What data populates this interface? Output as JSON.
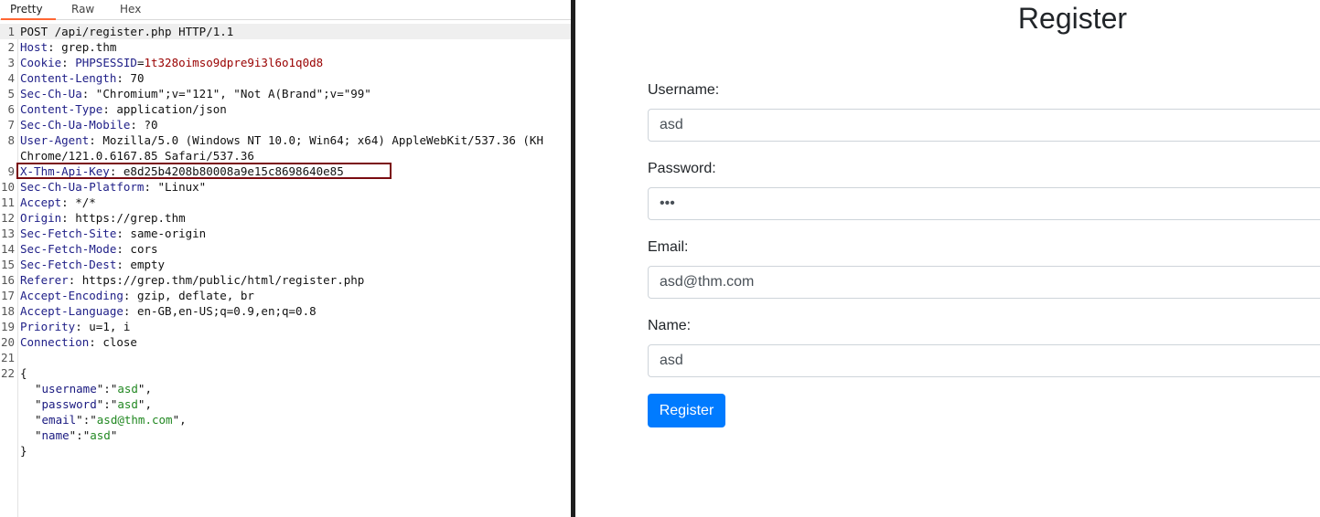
{
  "tabs": {
    "pretty": "Pretty",
    "raw": "Raw",
    "hex": "Hex"
  },
  "request": {
    "lines": [
      {
        "n": "1",
        "text": "POST /api/register.php HTTP/1.1"
      },
      {
        "n": "2",
        "name": "Host",
        "value": "grep.thm"
      },
      {
        "n": "3",
        "name": "Cookie",
        "cookie_name": "PHPSESSID",
        "cookie_value": "1t328oimso9dpre9i3l6o1q0d8"
      },
      {
        "n": "4",
        "name": "Content-Length",
        "value": "70"
      },
      {
        "n": "5",
        "name": "Sec-Ch-Ua",
        "value": "\"Chromium\";v=\"121\", \"Not A(Brand\";v=\"99\""
      },
      {
        "n": "6",
        "name": "Content-Type",
        "value": "application/json"
      },
      {
        "n": "7",
        "name": "Sec-Ch-Ua-Mobile",
        "value": "?0"
      },
      {
        "n": "8",
        "name": "User-Agent",
        "value": "Mozilla/5.0 (Windows NT 10.0; Win64; x64) AppleWebKit/537.36 (KH"
      },
      {
        "n": "",
        "text": "Chrome/121.0.6167.85 Safari/537.36"
      },
      {
        "n": "9",
        "name": "X-Thm-Api-Key",
        "value": "e8d25b4208b80008a9e15c8698640e85"
      },
      {
        "n": "10",
        "name": "Sec-Ch-Ua-Platform",
        "value": "\"Linux\""
      },
      {
        "n": "11",
        "name": "Accept",
        "value": "*/*"
      },
      {
        "n": "12",
        "name": "Origin",
        "value": "https://grep.thm"
      },
      {
        "n": "13",
        "name": "Sec-Fetch-Site",
        "value": "same-origin"
      },
      {
        "n": "14",
        "name": "Sec-Fetch-Mode",
        "value": "cors"
      },
      {
        "n": "15",
        "name": "Sec-Fetch-Dest",
        "value": "empty"
      },
      {
        "n": "16",
        "name": "Referer",
        "value": "https://grep.thm/public/html/register.php"
      },
      {
        "n": "17",
        "name": "Accept-Encoding",
        "value": "gzip, deflate, br"
      },
      {
        "n": "18",
        "name": "Accept-Language",
        "value": "en-GB,en-US;q=0.9,en;q=0.8"
      },
      {
        "n": "19",
        "name": "Priority",
        "value": "u=1, i"
      },
      {
        "n": "20",
        "name": "Connection",
        "value": "close"
      },
      {
        "n": "21",
        "text": ""
      },
      {
        "n": "22",
        "text": "{"
      },
      {
        "n": "",
        "key": "username",
        "val": "asd",
        "trail": ","
      },
      {
        "n": "",
        "key": "password",
        "val": "asd",
        "trail": ","
      },
      {
        "n": "",
        "key": "email",
        "val": "asd@thm.com",
        "trail": ","
      },
      {
        "n": "",
        "key": "name",
        "val": "asd",
        "trail": ""
      },
      {
        "n": "",
        "text": "}"
      }
    ]
  },
  "register": {
    "title": "Register",
    "username_label": "Username:",
    "username_value": "asd",
    "password_label": "Password:",
    "password_value": "asd",
    "email_label": "Email:",
    "email_value": "asd@thm.com",
    "name_label": "Name:",
    "name_value": "asd",
    "button_label": "Register"
  },
  "colors": {
    "accent_tab": "#ff6633",
    "highlight_box": "#7a0b10",
    "button": "#007bff"
  }
}
